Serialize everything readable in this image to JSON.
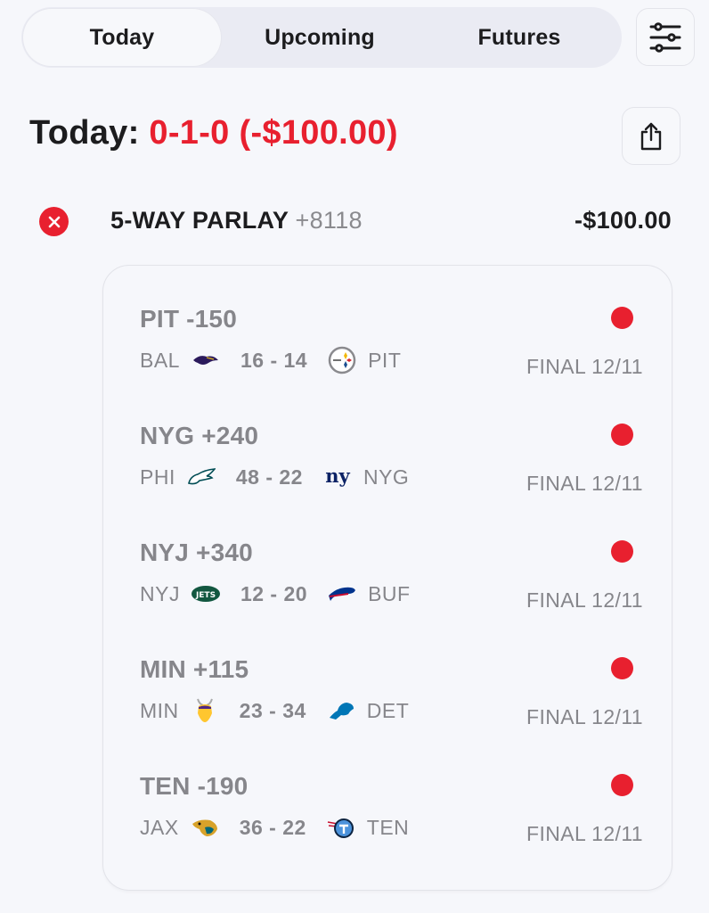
{
  "tabs": [
    {
      "label": "Today",
      "active": true
    },
    {
      "label": "Upcoming",
      "active": false
    },
    {
      "label": "Futures",
      "active": false
    }
  ],
  "toolbar": {
    "filter_icon": "sliders-icon",
    "share_icon": "share-icon"
  },
  "summary": {
    "label": "Today:",
    "record": "0-1-0",
    "net": "(-$100.00)"
  },
  "colors": {
    "loss": "#e8202f",
    "muted": "#86868b",
    "text": "#1c1c1e",
    "background": "#f6f7fb"
  },
  "bet": {
    "status": "lost",
    "title": "5-WAY PARLAY",
    "odds": "+8118",
    "amount": "-$100.00",
    "legs": [
      {
        "pick": "PIT -150",
        "away": "BAL",
        "away_logo": "ravens-logo",
        "score": "16 - 14",
        "home": "PIT",
        "home_logo": "steelers-logo",
        "status": "FINAL 12/11",
        "result": "lost"
      },
      {
        "pick": "NYG +240",
        "away": "PHI",
        "away_logo": "eagles-logo",
        "score": "48 - 22",
        "home": "NYG",
        "home_logo": "giants-logo",
        "status": "FINAL 12/11",
        "result": "lost"
      },
      {
        "pick": "NYJ +340",
        "away": "NYJ",
        "away_logo": "jets-logo",
        "score": "12 - 20",
        "home": "BUF",
        "home_logo": "bills-logo",
        "status": "FINAL 12/11",
        "result": "lost"
      },
      {
        "pick": "MIN +115",
        "away": "MIN",
        "away_logo": "vikings-logo",
        "score": "23 - 34",
        "home": "DET",
        "home_logo": "lions-logo",
        "status": "FINAL 12/11",
        "result": "lost"
      },
      {
        "pick": "TEN -190",
        "away": "JAX",
        "away_logo": "jaguars-logo",
        "score": "36 - 22",
        "home": "TEN",
        "home_logo": "titans-logo",
        "status": "FINAL 12/11",
        "result": "lost"
      }
    ]
  }
}
